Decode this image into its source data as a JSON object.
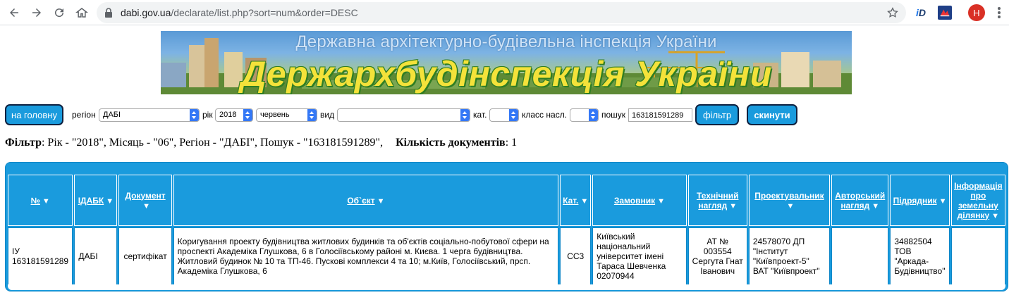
{
  "browser": {
    "url_host": "dabi.gov.ua",
    "url_path": "/declarate/list.php?sort=num&order=DESC",
    "avatar_letter": "H",
    "ext1_letters": [
      "i",
      "D"
    ]
  },
  "banner": {
    "subtitle": "Державна архітектурно-будівельна інспекція України",
    "title": "Держархбудінспекція України"
  },
  "filters": {
    "home_button": "на головну",
    "region_label": "регіон",
    "region_value": "ДАБІ",
    "year_label": "рік",
    "year_value": "2018",
    "month_value": "червень",
    "type_label": "вид",
    "type_value": "",
    "cat_label": "кат.",
    "cat_value": "",
    "class_label": "класс насл.",
    "class_value": "",
    "search_label": "пошук",
    "search_value": "163181591289",
    "filter_button": "фільтр",
    "reset_button": "скинути"
  },
  "summary": {
    "filter_label": "Фільтр",
    "filter_text": ": Рік - \"2018\", Місяць - \"06\", Регіон - \"ДАБІ\", Пошук - \"163181591289\",",
    "count_label": "Кількість документів",
    "count_value": ": 1"
  },
  "table": {
    "sort_glyph": "▼",
    "headers": [
      {
        "label": "№"
      },
      {
        "label": "ІДАБК"
      },
      {
        "label": "Документ"
      },
      {
        "label": "Об`єкт"
      },
      {
        "label": "Кат."
      },
      {
        "label": "Замовник"
      },
      {
        "label": "Технічний нагляд"
      },
      {
        "label": "Проектувальник"
      },
      {
        "label": "Авторський нагляд"
      },
      {
        "label": "Підрядник"
      },
      {
        "label": "Інформація про земельну ділянку"
      }
    ],
    "rows": [
      {
        "num": "ІУ 163181591289",
        "idabk": "ДАБІ",
        "document": "сертифікат",
        "object": "Коригування проекту будівництва житлових будинків та об'єктів соціально-побутової сфери на проспекті Академіка Глушкова, 6 в Голосіївському районі м. Києва. 1 черга будівництва. Житловий будинок № 10 та ТП-46. Пускові комплекси 4 та 10; м.Київ, Голосіївський, прсп. Академіка Глушкова, 6",
        "cat": "СС3",
        "customer": "Київський національний університет імені Тараса Шевченка 02070944",
        "tech_supervision": "АТ № 003554 Сергута Гнат Іванович",
        "designer": "24578070 ДП \"Інститут \"Київпроект-5\" ВАТ \"Київпроект\"",
        "author_supervision": "",
        "contractor": "34882504 ТОВ \"Аркада-Будівництво\"",
        "land_info": ""
      }
    ]
  },
  "colors": {
    "accent_blue": "#1a9bdd",
    "button_border": "#0e2140",
    "banner_title_yellow": "#f4e23a"
  }
}
